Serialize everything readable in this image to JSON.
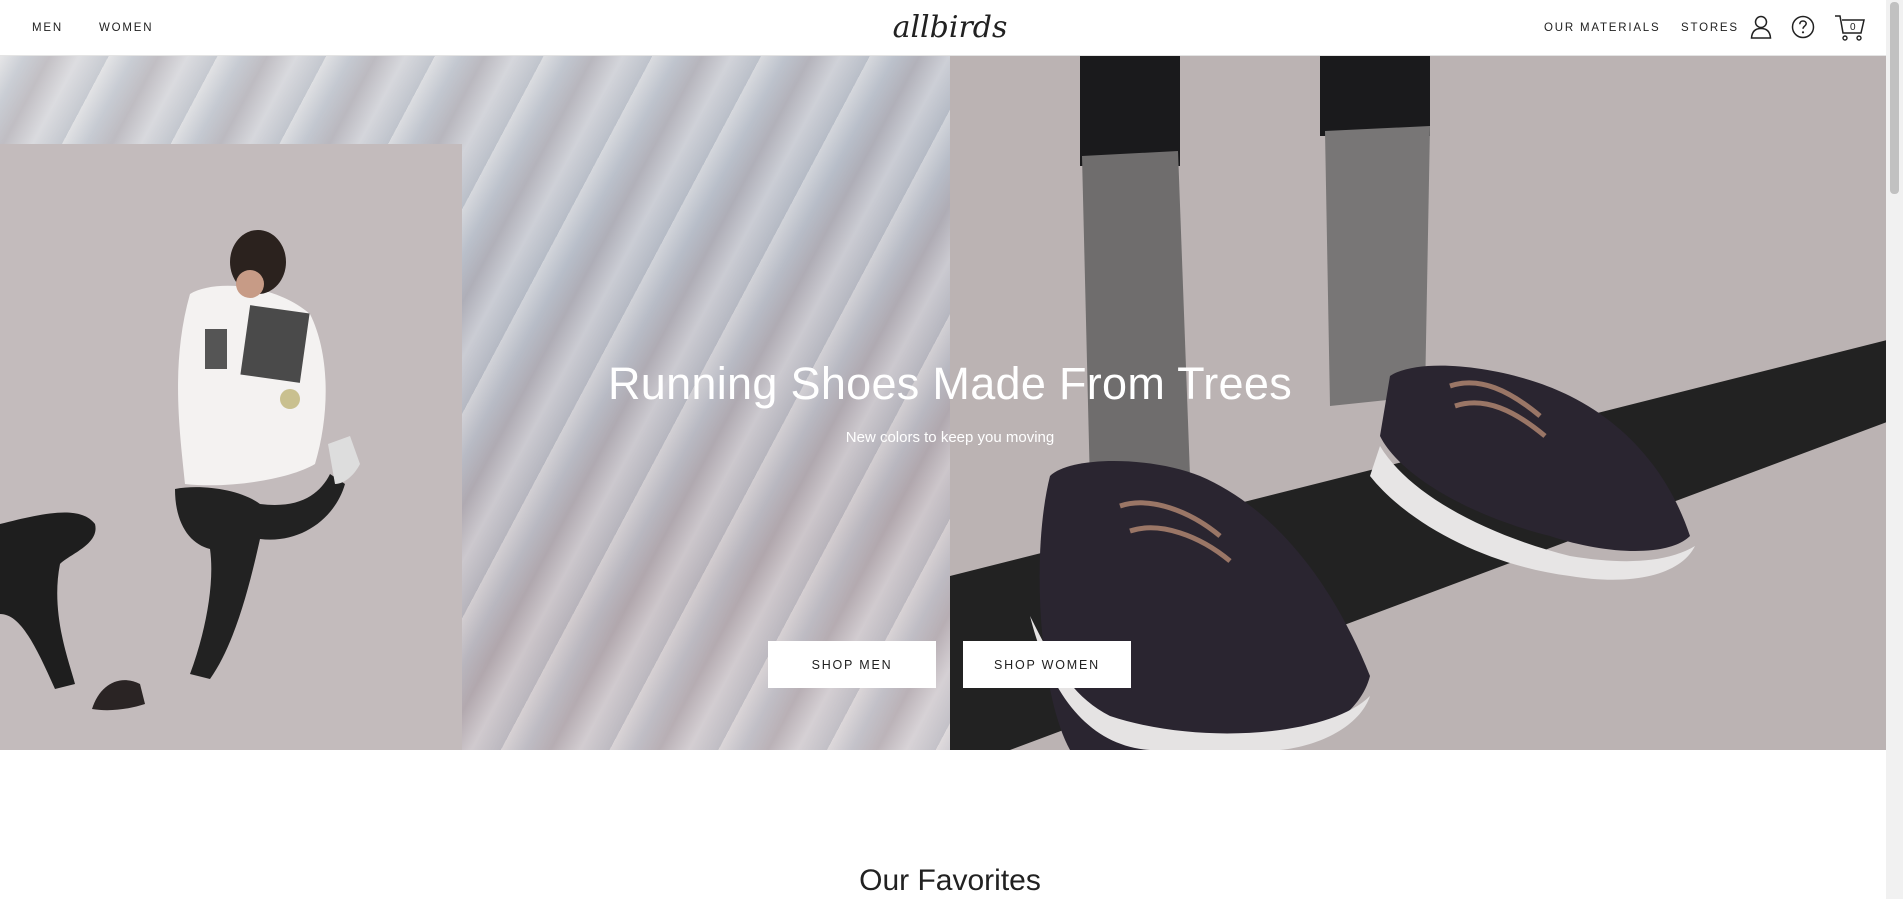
{
  "header": {
    "nav_left": [
      "MEN",
      "WOMEN"
    ],
    "logo_text": "allbirds",
    "nav_right": [
      "OUR MATERIALS",
      "STORES"
    ],
    "cart_count": "0",
    "icons": [
      "account-icon",
      "help-icon",
      "cart-icon"
    ]
  },
  "hero": {
    "title": "Running Shoes Made From Trees",
    "subtitle": "New colors to keep you moving",
    "buttons": [
      "SHOP MEN",
      "SHOP WOMEN"
    ]
  },
  "favorites": {
    "title": "Our Favorites"
  }
}
